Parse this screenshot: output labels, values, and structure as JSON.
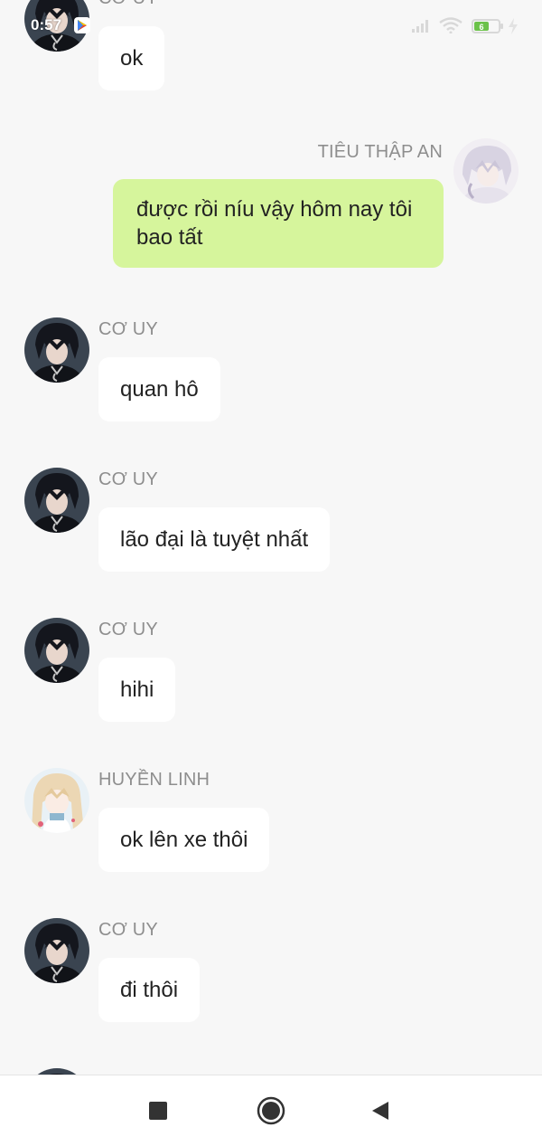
{
  "status_bar": {
    "time": "0:57",
    "icons": [
      "play-store-icon",
      "signal-icon",
      "wifi-icon",
      "battery-icon",
      "charging-icon"
    ],
    "battery_level": "6"
  },
  "messages": [
    {
      "side": "incoming",
      "sender": "CƠ UY",
      "text": "ok",
      "avatar": "avatar-dark-hair"
    },
    {
      "side": "outgoing",
      "sender": "TIÊU THẬP AN",
      "text": "được rồi níu vậy hôm nay tôi bao tất",
      "avatar": "avatar-white-hair"
    },
    {
      "side": "incoming",
      "sender": "CƠ UY",
      "text": "quan hô",
      "avatar": "avatar-dark-hair"
    },
    {
      "side": "incoming",
      "sender": "CƠ UY",
      "text": "lão đại là tuyệt nhất",
      "avatar": "avatar-dark-hair"
    },
    {
      "side": "incoming",
      "sender": "CƠ UY",
      "text": "hihi",
      "avatar": "avatar-dark-hair"
    },
    {
      "side": "incoming",
      "sender": "HUYỀN LINH",
      "text": "ok lên xe thôi",
      "avatar": "avatar-blonde-hair"
    },
    {
      "side": "incoming",
      "sender": "CƠ UY",
      "text": "đi thôi",
      "avatar": "avatar-dark-hair"
    }
  ],
  "colors": {
    "background": "#f7f7f7",
    "incoming_bubble": "#ffffff",
    "outgoing_bubble": "#d6f59c",
    "sender_text": "#8e8e8e",
    "message_text": "#222222"
  },
  "nav_bar": {
    "buttons": [
      "recents-button",
      "home-button",
      "back-button"
    ]
  }
}
